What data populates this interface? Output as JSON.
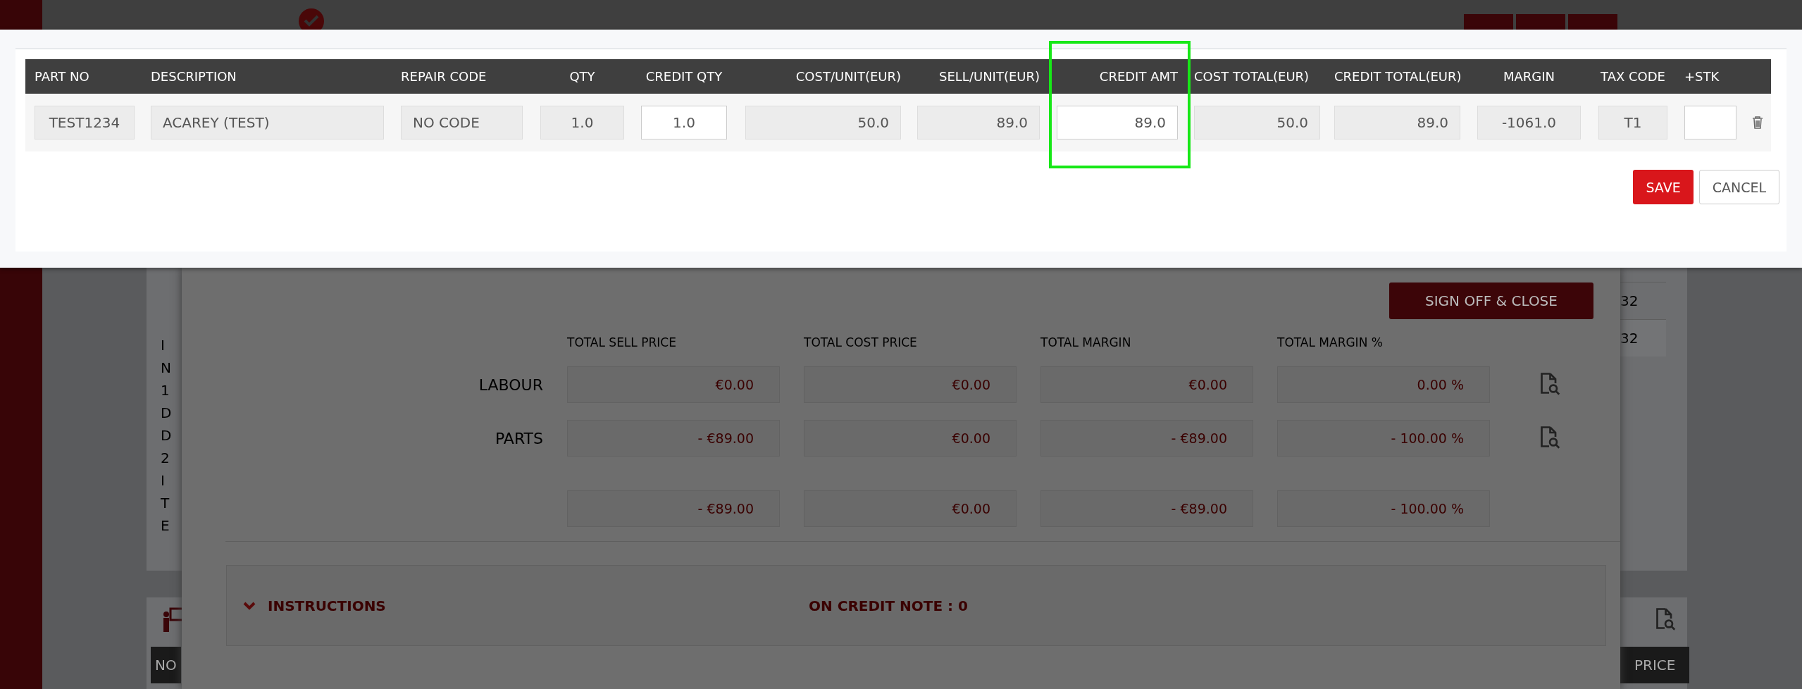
{
  "credit_modal": {
    "columns": [
      {
        "label": "PART NO",
        "highlighted": false
      },
      {
        "label": "DESCRIPTION",
        "highlighted": false
      },
      {
        "label": "REPAIR CODE",
        "highlighted": false
      },
      {
        "label": "QTY",
        "highlighted": false
      },
      {
        "label": "CREDIT QTY",
        "highlighted": false
      },
      {
        "label": "COST/UNIT(EUR)",
        "highlighted": false
      },
      {
        "label": "SELL/UNIT(EUR)",
        "highlighted": false
      },
      {
        "label": "CREDIT AMT",
        "highlighted": true
      },
      {
        "label": "COST TOTAL(EUR)",
        "highlighted": false
      },
      {
        "label": "CREDIT TOTAL(EUR)",
        "highlighted": false
      },
      {
        "label": "MARGIN",
        "highlighted": false
      },
      {
        "label": "TAX CODE",
        "highlighted": false
      },
      {
        "label": "+STK",
        "highlighted": false
      }
    ],
    "row": [
      {
        "value": "TEST1234",
        "editable": false
      },
      {
        "value": "ACAREY (TEST)",
        "editable": false
      },
      {
        "value": "NO CODE",
        "editable": false
      },
      {
        "value": "1.0",
        "editable": false
      },
      {
        "value": "1.0",
        "editable": true
      },
      {
        "value": "50.0",
        "editable": false
      },
      {
        "value": "89.0",
        "editable": false
      },
      {
        "value": "89.0",
        "editable": true
      },
      {
        "value": "50.0",
        "editable": false
      },
      {
        "value": "89.0",
        "editable": false
      },
      {
        "value": "-1061.0",
        "editable": false
      },
      {
        "value": "T1",
        "editable": false
      },
      {
        "editable": true
      }
    ],
    "buttons": [
      {
        "label": "SAVE",
        "kind": "primary"
      },
      {
        "label": "CANCEL",
        "kind": "secondary"
      }
    ]
  },
  "job_modal": {
    "sign_off_button": "SIGN OFF & CLOSE",
    "totals": {
      "columns": [
        "TOTAL SELL PRICE",
        "TOTAL COST PRICE",
        "TOTAL MARGIN",
        "TOTAL MARGIN %"
      ],
      "rows": [
        {
          "label": "LABOUR",
          "values": [
            "€0.00",
            "€0.00",
            "€0.00",
            "0.00 %"
          ]
        },
        {
          "label": "PARTS",
          "values": [
            "- €89.00",
            "€0.00",
            "- €89.00",
            "- 100.00 %"
          ]
        },
        {
          "values": [
            "- €89.00",
            "€0.00",
            "- €89.00",
            "- 100.00 %"
          ]
        }
      ]
    },
    "instructions": {
      "title": "INSTRUCTIONS",
      "expanded": true,
      "note": "ON CREDIT NOTE : 0"
    }
  },
  "background": {
    "left_fragments": [
      "I",
      "N",
      "1",
      "D",
      "D",
      "2",
      "I",
      "T",
      "E"
    ],
    "right_cells": [
      "32",
      "32"
    ],
    "left_button": "NO",
    "right_button": "PRICE"
  }
}
